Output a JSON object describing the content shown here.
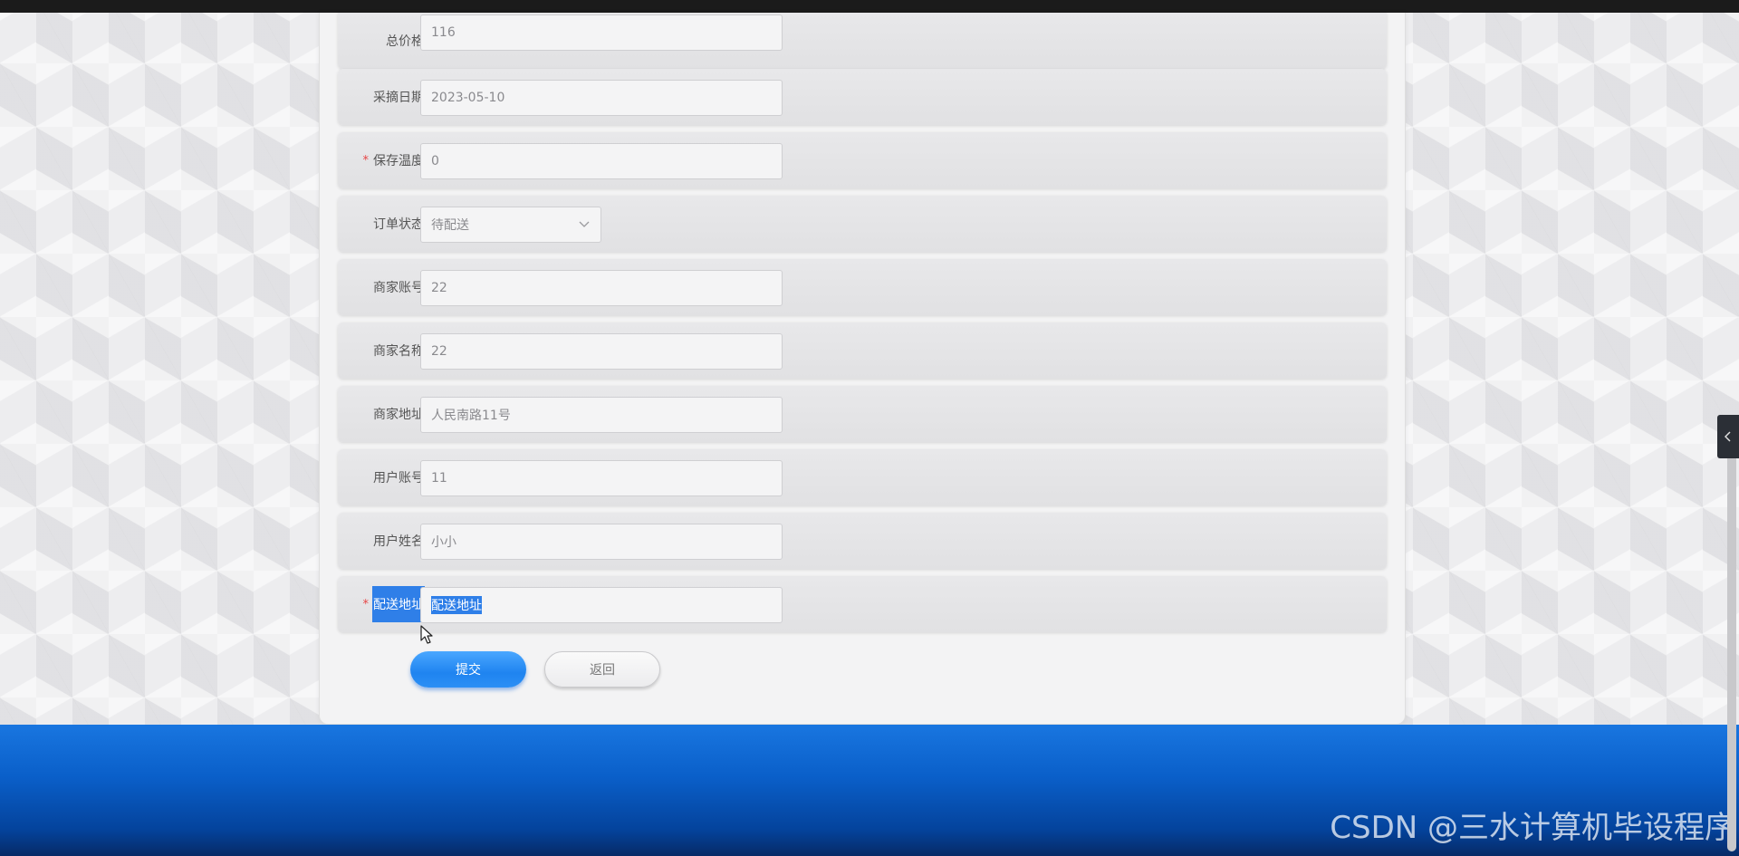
{
  "form": {
    "fields": [
      {
        "label": "总价格",
        "value": "116",
        "required": false
      },
      {
        "label": "采摘日期",
        "value": "2023-05-10",
        "required": false
      },
      {
        "label": "保存温度",
        "value": "0",
        "required": true
      },
      {
        "label": "订单状态",
        "value": "待配送",
        "required": false,
        "type": "select"
      },
      {
        "label": "商家账号",
        "value": "22",
        "required": false
      },
      {
        "label": "商家名称",
        "value": "22",
        "required": false
      },
      {
        "label": "商家地址",
        "value": "人民南路11号",
        "required": false
      },
      {
        "label": "用户账号",
        "value": "11",
        "required": false
      },
      {
        "label": "用户姓名",
        "value": "小小",
        "required": false
      },
      {
        "label": "配送地址",
        "value": "配送地址",
        "required": true
      }
    ],
    "required_mark": "*",
    "submit_label": "提交",
    "back_label": "返回"
  },
  "watermark": "CSDN @三水计算机毕设程序",
  "colors": {
    "accent": "#1f84f0",
    "required": "#e64545",
    "selection": "#2f7fe8",
    "footer": "#0a5fc9"
  },
  "icons": {
    "select_arrow": "chevron-down-icon",
    "side_toggle": "chevron-left-icon",
    "cursor": "mouse-cursor-icon"
  }
}
